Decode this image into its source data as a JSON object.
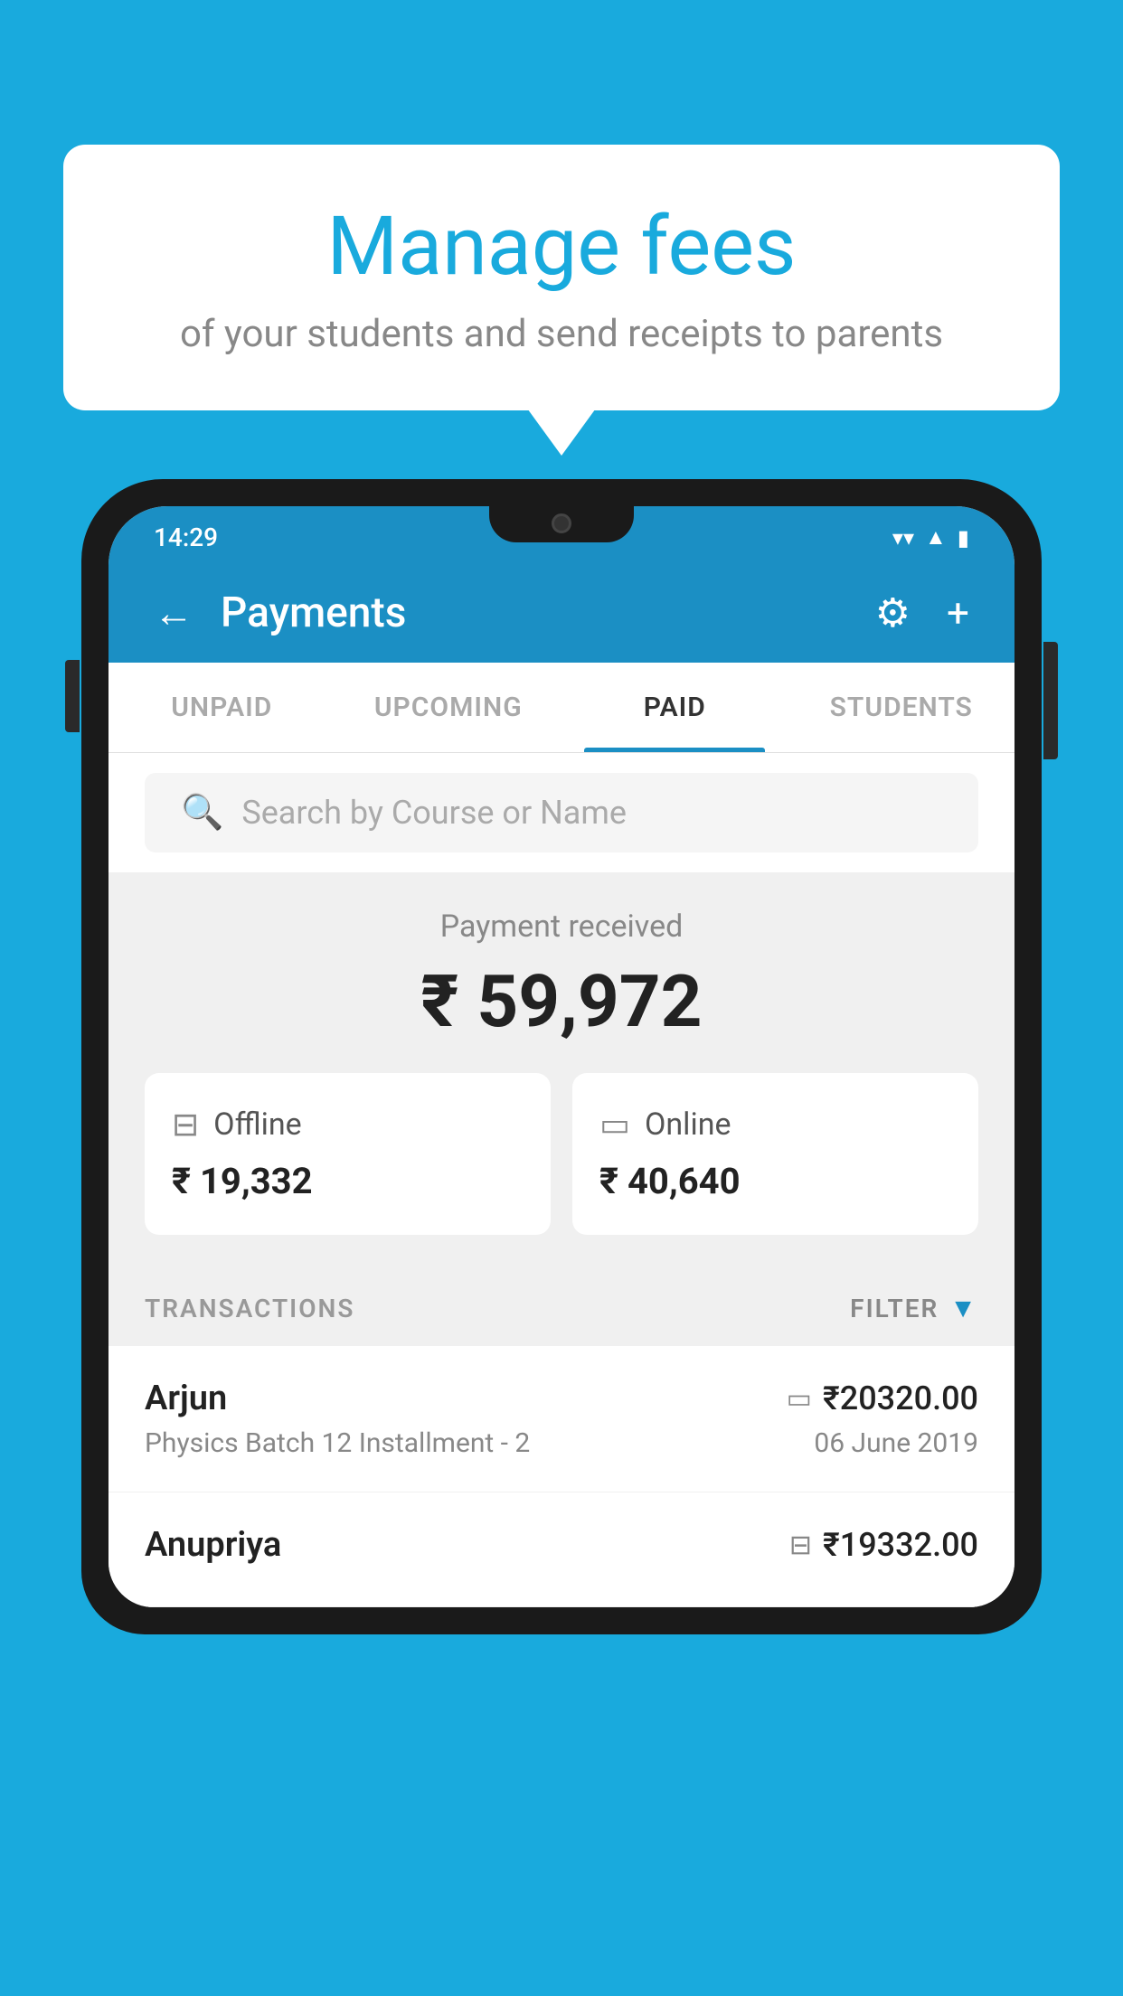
{
  "background_color": "#19AADD",
  "speech_bubble": {
    "title": "Manage fees",
    "subtitle": "of your students and send receipts to parents"
  },
  "status_bar": {
    "time": "14:29",
    "wifi_icon": "wifi",
    "signal_icon": "signal",
    "battery_icon": "battery"
  },
  "header": {
    "title": "Payments",
    "back_label": "←",
    "settings_label": "⚙",
    "add_label": "+"
  },
  "tabs": [
    {
      "label": "UNPAID",
      "active": false
    },
    {
      "label": "UPCOMING",
      "active": false
    },
    {
      "label": "PAID",
      "active": true
    },
    {
      "label": "STUDENTS",
      "active": false
    }
  ],
  "search": {
    "placeholder": "Search by Course or Name"
  },
  "payment_summary": {
    "label": "Payment received",
    "total": "₹ 59,972",
    "offline": {
      "label": "Offline",
      "amount": "₹ 19,332"
    },
    "online": {
      "label": "Online",
      "amount": "₹ 40,640"
    }
  },
  "transactions": {
    "header_label": "TRANSACTIONS",
    "filter_label": "FILTER",
    "items": [
      {
        "name": "Arjun",
        "description": "Physics Batch 12 Installment - 2",
        "amount": "₹20320.00",
        "date": "06 June 2019",
        "type": "online"
      },
      {
        "name": "Anupriya",
        "description": "",
        "amount": "₹19332.00",
        "date": "",
        "type": "offline"
      }
    ]
  }
}
